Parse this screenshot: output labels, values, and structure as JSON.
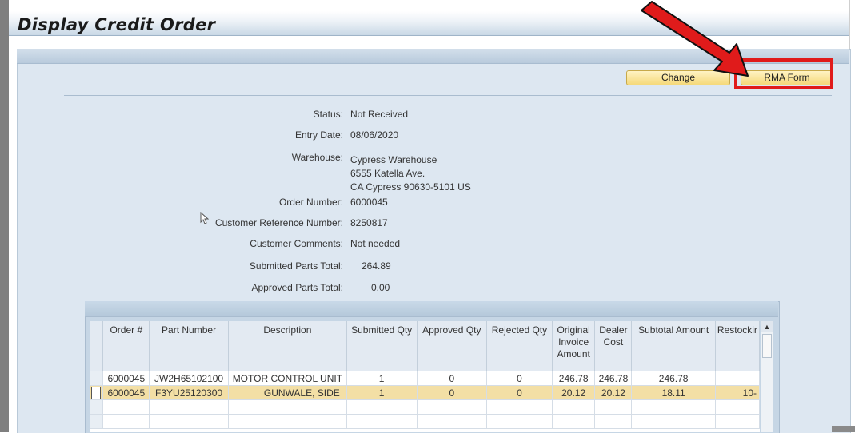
{
  "page": {
    "title": "Display Credit Order"
  },
  "toolbar": {
    "change_label": "Change",
    "rma_label": "RMA Form"
  },
  "details": {
    "status_label": "Status:",
    "status_value": "Not Received",
    "entry_date_label": "Entry Date:",
    "entry_date_value": "08/06/2020",
    "warehouse_label": "Warehouse:",
    "warehouse_line1": "Cypress Warehouse",
    "warehouse_line2": "6555 Katella Ave.",
    "warehouse_line3": "CA Cypress 90630-5101 US",
    "order_number_label": "Order Number:",
    "order_number_value": "6000045",
    "customer_ref_label": "Customer Reference Number:",
    "customer_ref_value": "8250817",
    "customer_comments_label": "Customer Comments:",
    "customer_comments_value": "Not needed",
    "submitted_total_label": "Submitted Parts Total:",
    "submitted_total_value": "264.89",
    "approved_total_label": "Approved Parts Total:",
    "approved_total_value": "0.00"
  },
  "table": {
    "columns": [
      "Order #",
      "Part Number",
      "Description",
      "Submitted Qty",
      "Approved Qty",
      "Rejected Qty",
      "Original Invoice Amount",
      "Dealer Cost",
      "Subtotal Amount",
      "Restockir"
    ],
    "rows": [
      [
        "6000045",
        "JW2H65102100",
        "MOTOR CONTROL UNIT",
        "1",
        "0",
        "0",
        "246.78",
        "246.78",
        "246.78",
        ""
      ],
      [
        "6000045",
        "F3YU25120300",
        "GUNWALE, SIDE",
        "1",
        "0",
        "0",
        "20.12",
        "20.12",
        "18.11",
        "10-"
      ]
    ]
  },
  "colors": {
    "highlight": "#e01b1b",
    "arrow": "#e01b1b",
    "button": "#f5d97a",
    "panel": "#dde7f1",
    "selected_row": "#f3dfa5"
  },
  "icons": [
    "mouse-pointer-icon",
    "scroll-up-icon",
    "red-arrow-annotation"
  ]
}
